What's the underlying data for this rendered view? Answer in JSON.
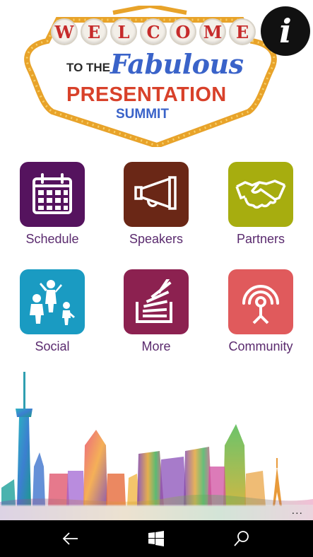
{
  "logo": {
    "welcome_letters": [
      "W",
      "E",
      "L",
      "C",
      "O",
      "M",
      "E"
    ],
    "to_the": "TO THE",
    "fabulous": "Fabulous",
    "presentation": "PRESENTATION",
    "summit": "SUMMIT"
  },
  "info_button": {
    "glyph": "i",
    "icon": "info-icon"
  },
  "tiles": [
    {
      "label": "Schedule",
      "icon": "calendar-icon",
      "color": "#55135e"
    },
    {
      "label": "Speakers",
      "icon": "megaphone-icon",
      "color": "#6a2716"
    },
    {
      "label": "Partners",
      "icon": "handshake-icon",
      "color": "#a7ad0f"
    },
    {
      "label": "Social",
      "icon": "people-icon",
      "color": "#1a9bc2"
    },
    {
      "label": "More",
      "icon": "stack-icon",
      "color": "#8c2150"
    },
    {
      "label": "Community",
      "icon": "broadcast-icon",
      "color": "#e05a5c"
    }
  ],
  "appbar": {
    "more": "..."
  },
  "system_nav": {
    "back_icon": "back-arrow-icon",
    "start_icon": "windows-icon",
    "search_icon": "search-icon"
  }
}
